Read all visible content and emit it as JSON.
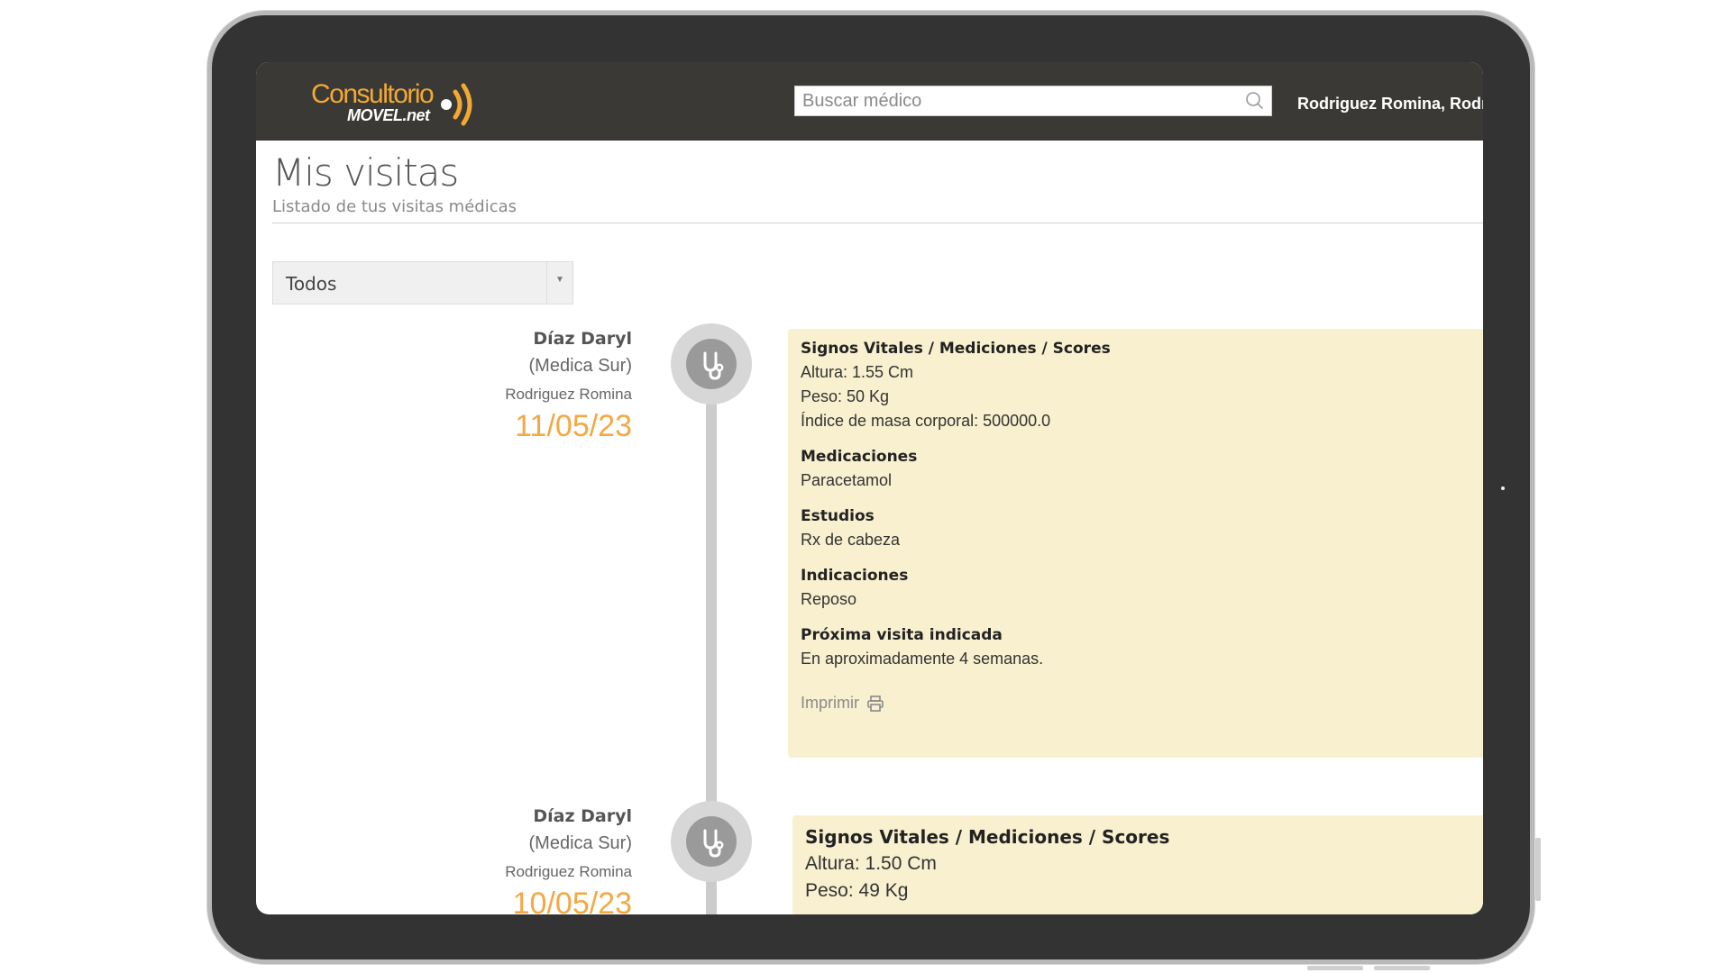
{
  "header": {
    "logo_top": "Consultorio",
    "logo_bottom": "MOVEL.net",
    "search_placeholder": "Buscar médico",
    "user_name": "Rodriguez Romina, Rodri"
  },
  "page": {
    "title": "Mis visitas",
    "subtitle": "Listado de tus visitas médicas"
  },
  "filter": {
    "selected": "Todos"
  },
  "colors": {
    "accent": "#f5a742",
    "card_bg": "#f8f0cf",
    "header_bg": "#3a3935"
  },
  "visits": [
    {
      "doctor": "Díaz Daryl",
      "clinic": "(Medica Sur)",
      "patient": "Rodriguez Romina",
      "date": "11/05/23",
      "icon": "stethoscope-icon",
      "sections": [
        {
          "title": "Signos Vitales / Mediciones / Scores",
          "lines": [
            "Altura: 1.55 Cm",
            "Peso: 50 Kg",
            "Índice de masa corporal: 500000.0"
          ]
        },
        {
          "title": "Medicaciones",
          "lines": [
            "Paracetamol"
          ]
        },
        {
          "title": "Estudios",
          "lines": [
            "Rx de cabeza"
          ]
        },
        {
          "title": "Indicaciones",
          "lines": [
            "Reposo"
          ]
        },
        {
          "title": "Próxima visita indicada",
          "lines": [
            "En aproximadamente 4 semanas."
          ]
        }
      ],
      "print_label": "Imprimir"
    },
    {
      "doctor": "Díaz Daryl",
      "clinic": "(Medica Sur)",
      "patient": "Rodriguez Romina",
      "date": "10/05/23",
      "icon": "stethoscope-icon",
      "sections": [
        {
          "title": "Signos Vitales / Mediciones / Scores",
          "lines": [
            "Altura: 1.50 Cm",
            "Peso: 49 Kg"
          ]
        }
      ]
    }
  ]
}
